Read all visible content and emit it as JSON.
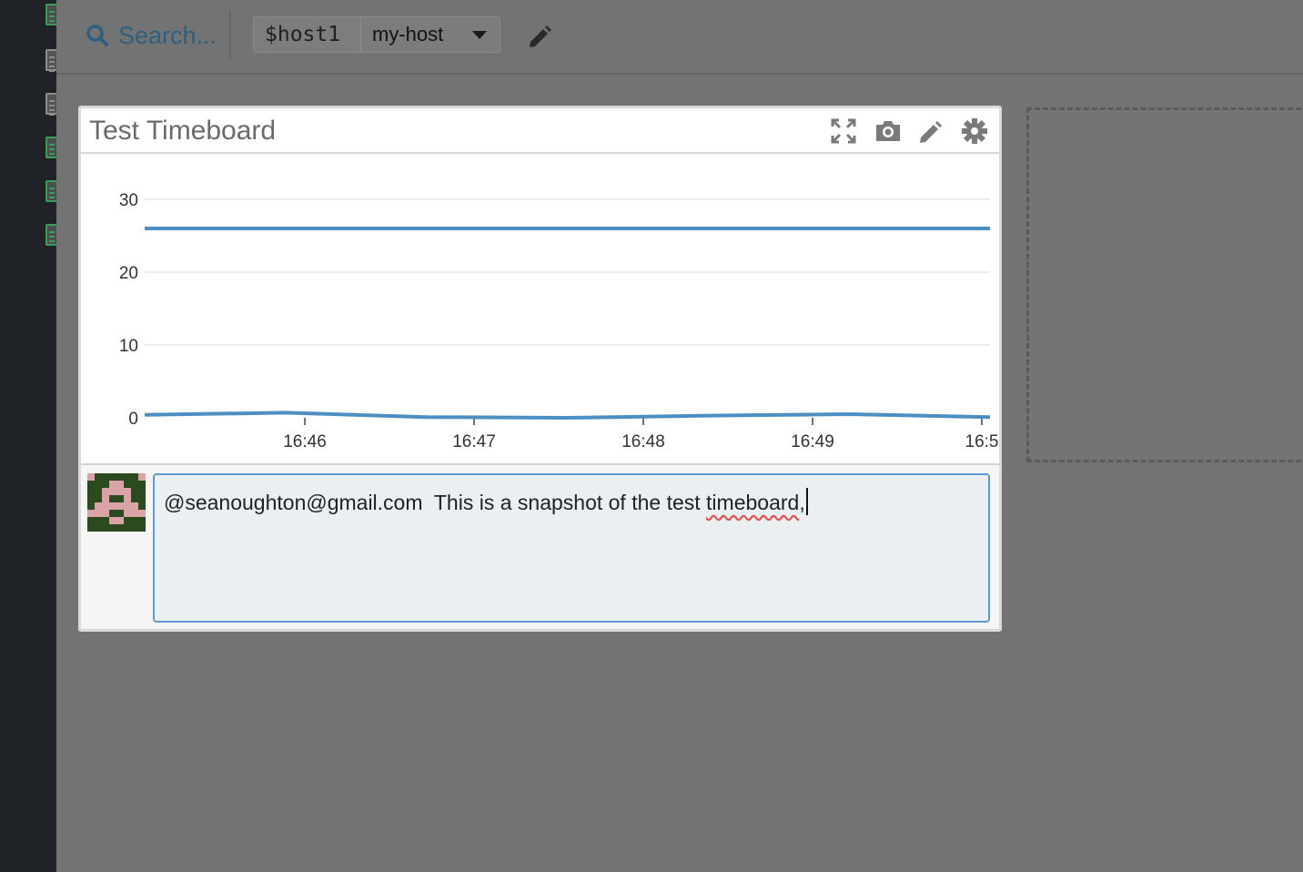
{
  "toolbar": {
    "search_placeholder": "Search...",
    "template_variable": {
      "name": "$host1",
      "value": "my-host"
    }
  },
  "widget": {
    "title": "Test Timeboard"
  },
  "chart_data": {
    "type": "line",
    "x_ticks": [
      "16:46",
      "16:47",
      "16:48",
      "16:49",
      "16:5"
    ],
    "y_ticks": [
      0,
      10,
      20,
      30
    ],
    "ylim": [
      0,
      30
    ],
    "series": [
      {
        "values": [
          26,
          26,
          26,
          26,
          26,
          26,
          26
        ]
      },
      {
        "values": [
          0.4,
          0.7,
          0.1,
          0,
          0.3,
          0.5,
          0.1
        ]
      }
    ],
    "grid": true,
    "color": "#4c8fc3"
  },
  "comment": {
    "mention": "@seanoughton@gmail.com",
    "text_before": "  This is a snapshot of the test ",
    "misspelled_word": "timeboard",
    "text_after": ","
  }
}
